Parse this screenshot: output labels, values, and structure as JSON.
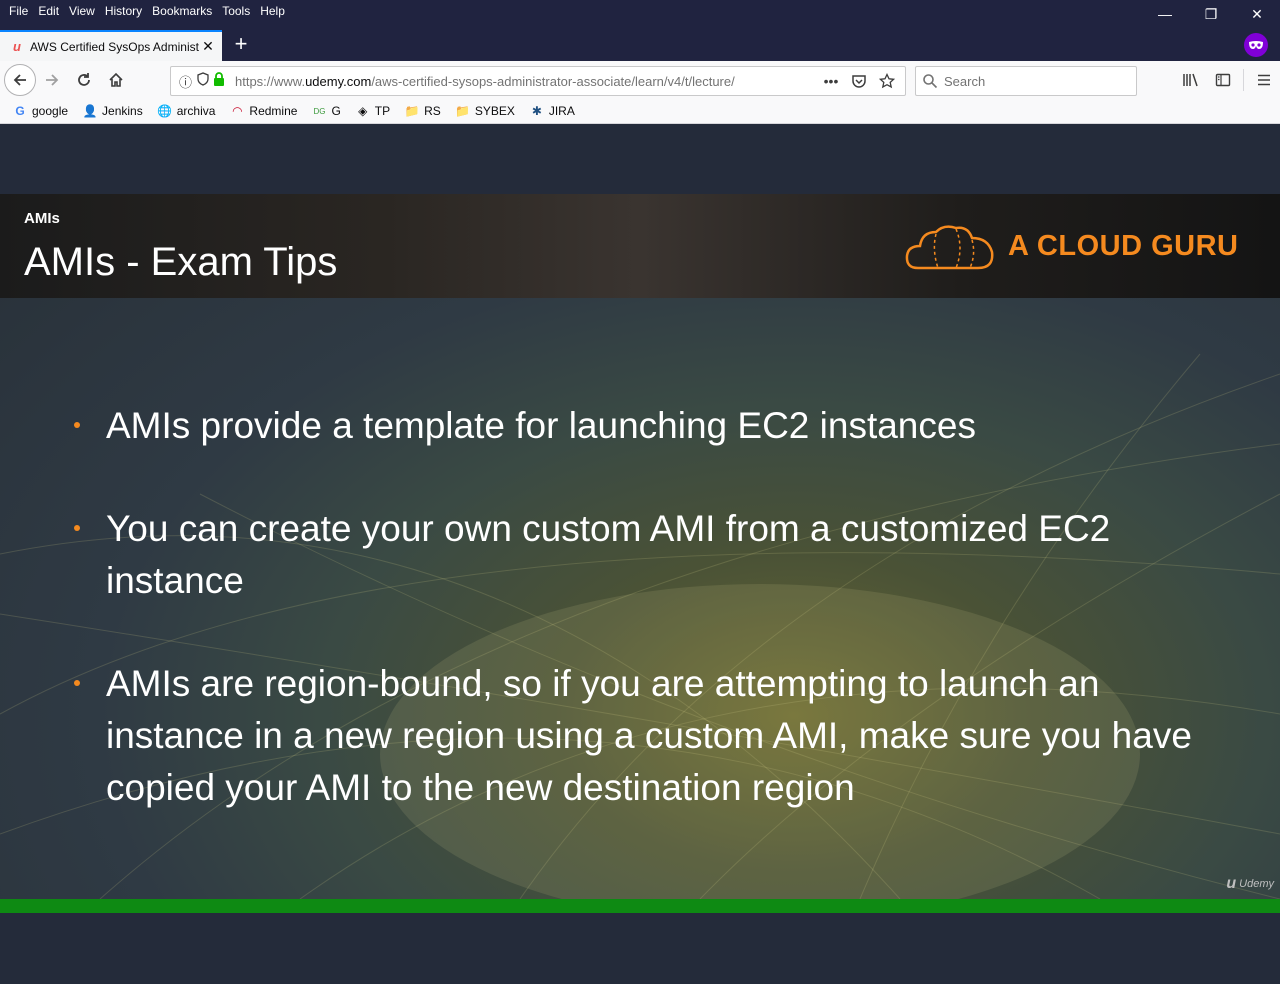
{
  "menu": [
    "File",
    "Edit",
    "View",
    "History",
    "Bookmarks",
    "Tools",
    "Help"
  ],
  "window": {
    "minimize": "—",
    "restore": "❐",
    "close": "✕"
  },
  "tab": {
    "title": "AWS Certified SysOps Administ",
    "close": "✕",
    "new_tab": "+"
  },
  "navbar": {
    "url_prefix": "https://www.",
    "url_host": "udemy.com",
    "url_path": "/aws-certified-sysops-administrator-associate/learn/v4/t/lecture/",
    "more": "•••",
    "search_placeholder": "Search"
  },
  "bookmarks": [
    {
      "label": "google",
      "icon": "G"
    },
    {
      "label": "Jenkins",
      "icon": "👤"
    },
    {
      "label": "archiva",
      "icon": "🌐"
    },
    {
      "label": "Redmine",
      "icon": "◠"
    },
    {
      "label": "G",
      "icon": "DG"
    },
    {
      "label": "TP",
      "icon": "◈"
    },
    {
      "label": "RS",
      "icon": "📁"
    },
    {
      "label": "SYBEX",
      "icon": "📁"
    },
    {
      "label": "JIRA",
      "icon": "✱"
    }
  ],
  "slide": {
    "section": "AMIs",
    "title": "AMIs - Exam Tips",
    "brand": "A CLOUD GURU",
    "bullets": [
      "AMIs provide a template for launching EC2 instances",
      "You can create your own custom AMI from a customized EC2 instance",
      "AMIs are region-bound, so if you are attempting to launch an instance in a new region using a custom AMI, make sure you have copied your AMI to the new destination region"
    ],
    "watermark": "Udemy"
  },
  "video": {
    "progress_percent": 100,
    "progress_color": "#0e8a13"
  },
  "colors": {
    "accent": "#f58a1f",
    "private": "#8000d7",
    "tab_highlight": "#0a84ff"
  }
}
